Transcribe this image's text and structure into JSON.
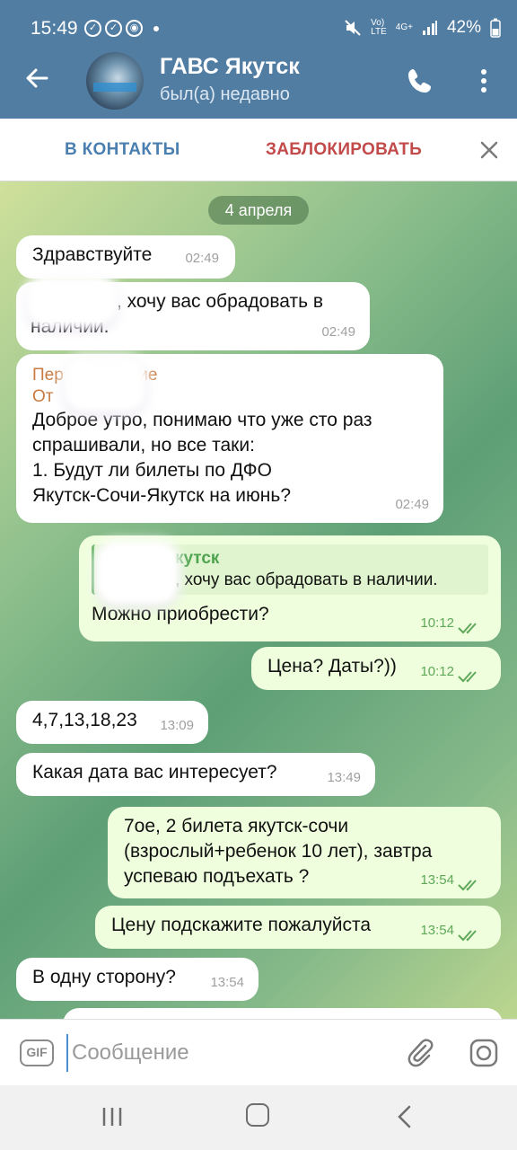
{
  "status": {
    "time": "15:49",
    "battery": "42%",
    "network": "4G+"
  },
  "header": {
    "title": "ГАВС Якутск",
    "subtitle": "был(а) недавно"
  },
  "contact_bar": {
    "add_contact": "В КОНТАКТЫ",
    "block": "ЗАБЛОКИРОВАТЬ"
  },
  "chat": {
    "date": "4 апреля",
    "messages": [
      {
        "dir": "in",
        "text": "Здравствуйте",
        "time": "02:49"
      },
      {
        "dir": "in",
        "text": ", хочу вас обрадовать в",
        "text2": "наличии.",
        "time": "02:49"
      },
      {
        "dir": "in",
        "forwarded": "Пер сообщение",
        "forwarded2": "От",
        "text": "Доброе утро, понимаю что уже сто раз",
        "text2": "спрашивали,  но все таки:",
        "text3": "1. Будут ли билеты по ДФО",
        "text4": "Якутск-Сочи-Якутск на июнь?",
        "time": "02:49"
      },
      {
        "dir": "out",
        "reply_name": "кутск",
        "reply_text": ", хочу вас обрадовать в наличии.",
        "text": "Можно приобрести?",
        "time": "10:12"
      },
      {
        "dir": "out",
        "text": "Цена? Даты?))",
        "time": "10:12"
      },
      {
        "dir": "in",
        "text": "4,7,13,18,23",
        "time": "13:09"
      },
      {
        "dir": "in",
        "text": "Какая дата вас интересует?",
        "time": "13:49"
      },
      {
        "dir": "out",
        "text": "7ое, 2 билета якутск-сочи",
        "text2": "(взрослый+ребенок 10 лет), завтра",
        "text3": "успеваю подъехать ?",
        "time": "13:54"
      },
      {
        "dir": "out",
        "text": "Цену подскажите пожалуйста",
        "time": "13:54"
      },
      {
        "dir": "in",
        "text": "В одну сторону?",
        "time": "13:54"
      }
    ]
  },
  "input": {
    "placeholder": "Сообщение",
    "gif_label": "GIF"
  },
  "colors": {
    "header": "#527da3",
    "outgoing_bubble": "#effedd",
    "incoming_bubble": "#ffffff",
    "block_red": "#c24a4a",
    "contact_blue": "#4a7fb0"
  }
}
